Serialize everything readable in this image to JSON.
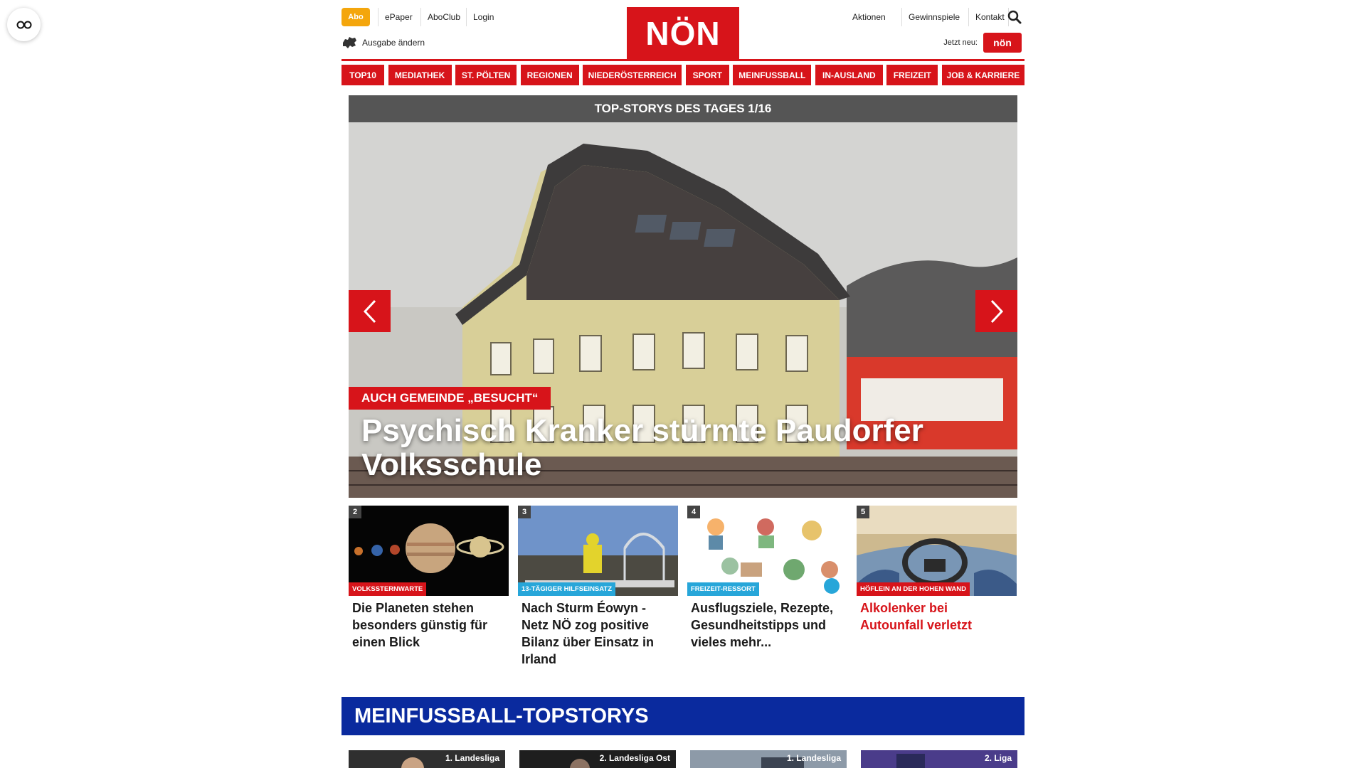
{
  "header": {
    "abo_label": "Abo",
    "top_links": [
      "ePaper",
      "AboClub",
      "Login"
    ],
    "edition_label": "Ausgabe ändern",
    "logo_text": "NÖN",
    "right_links": [
      "Aktionen",
      "Gewinnspiele",
      "Kontakt"
    ],
    "jetzt_label": "Jetzt neu:",
    "jetzt_logo_text": "nön",
    "search_icon": "search-icon"
  },
  "nav": {
    "items": [
      "Top10",
      "Mediathek",
      "St. Pölten",
      "Regionen",
      "Niederösterreich",
      "Sport",
      "meinfussball",
      "In-Ausland",
      "Freizeit",
      "Job & Karriere"
    ]
  },
  "hero": {
    "bar_title": "TOP-STORYS DES TAGES 1/16",
    "kicker": "AUCH GEMEINDE „BESUCHT“",
    "title": "Psychisch Kranker stürmte Paudorfer Volksschule",
    "prev_icon": "chevron-left-icon",
    "next_icon": "chevron-right-icon"
  },
  "teasers": [
    {
      "number": "2",
      "tag": "Volkssternwarte",
      "title": "Die Planeten stehen besonders günstig für einen Blick",
      "tag_color": "#d7141a",
      "title_color": "#1a1a1a"
    },
    {
      "number": "3",
      "tag": "13-tägiger Hilfseinsatz",
      "title": "Nach Sturm Éowyn - Netz NÖ zog positive Bilanz über Einsatz in Irland",
      "tag_color": "#27a6d9",
      "title_color": "#1a1a1a"
    },
    {
      "number": "4",
      "tag": "Freizeit-Ressort",
      "title": "Ausflugsziele, Rezepte, Gesundheitstipps und vieles mehr...",
      "tag_color": "#27a6d9",
      "title_color": "#1a1a1a"
    },
    {
      "number": "5",
      "tag": "Höflein an der Hohen Wand",
      "title": "Alkolenker bei Autounfall verletzt",
      "tag_color": "#d7141a",
      "title_color": "#d7141a"
    }
  ],
  "football": {
    "heading": "MEINFUSSBALL-TOPSTORYS",
    "cards": [
      "1. Landesliga",
      "2. Landesliga Ost",
      "1. Landesliga",
      "2. Liga"
    ]
  },
  "colors": {
    "brand_red": "#d7141a",
    "abo_orange": "#f4a60c",
    "football_blue": "#0a2a9e",
    "hero_bar_gray": "#555555"
  }
}
